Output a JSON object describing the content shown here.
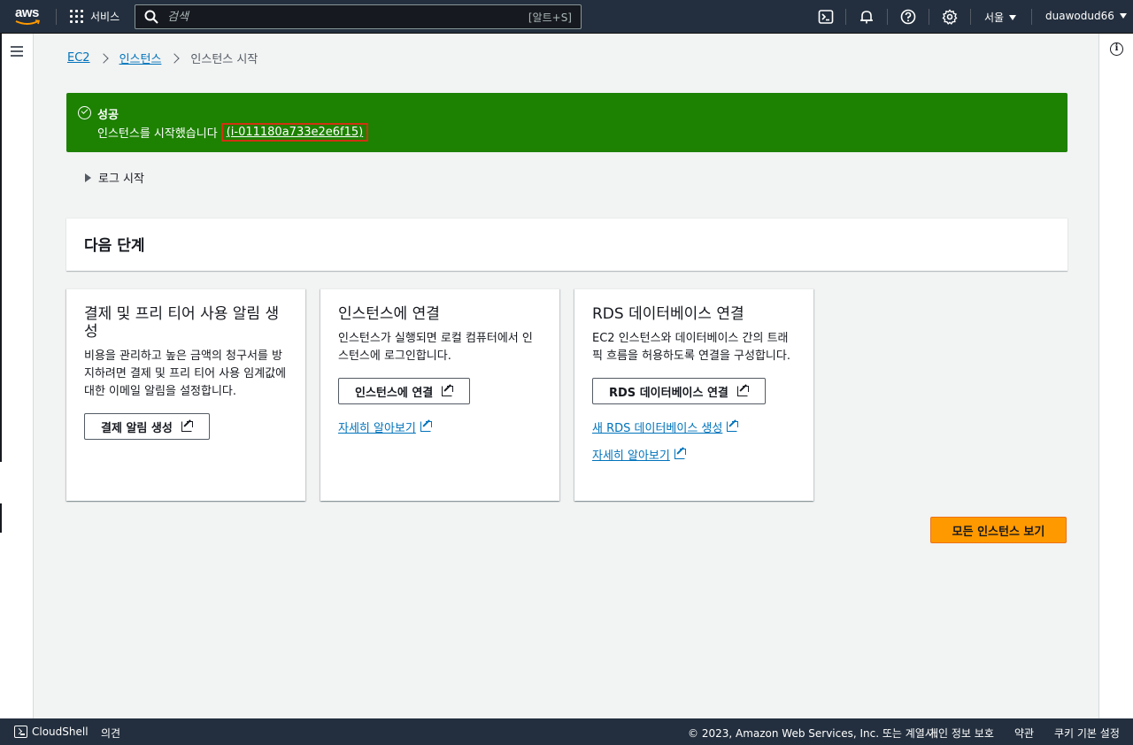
{
  "topnav": {
    "logo": "aws",
    "services_label": "서비스",
    "search_placeholder": "검색",
    "search_shortcut": "[알트+S]",
    "region": "서울",
    "username": "duawodud66",
    "icons": [
      "cloudshell-icon",
      "bell-icon",
      "help-icon",
      "gear-icon"
    ]
  },
  "breadcrumb": {
    "items": [
      "EC2",
      "인스턴스"
    ],
    "current": "인스턴스 시작"
  },
  "flash": {
    "title": "성공",
    "message": "인스턴스를 시작했습니다",
    "instance_id": "(i-011180a733e2e6f15)",
    "color": "#1d8102"
  },
  "log": {
    "label": "로그 시작"
  },
  "next_steps": {
    "title": "다음 단계"
  },
  "cards": [
    {
      "title": "결제 및 프리 티어 사용 알림 생성",
      "description": "비용을 관리하고 높은 금액의 청구서를 방지하려면 결제 및 프리 티어 사용 임계값에 대한 이메일 알림을 설정합니다.",
      "button": "결제 알림 생성"
    },
    {
      "title": "인스턴스에 연결",
      "description": "인스턴스가 실행되면 로컬 컴퓨터에서 인스턴스에 로그인합니다.",
      "button": "인스턴스에 연결",
      "link": "자세히 알아보기"
    },
    {
      "title": "RDS 데이터베이스 연결",
      "description": "EC2 인스턴스와 데이터베이스 간의 트래픽 흐름을 허용하도록 연결을 구성합니다.",
      "button": "RDS 데이터베이스 연결",
      "link1": "새 RDS 데이터베이스 생성",
      "link2": "자세히 알아보기"
    }
  ],
  "primary_button": "모든 인스턴스 보기",
  "footer": {
    "cloudshell": "CloudShell",
    "feedback": "의견",
    "copyright": "© 2023, Amazon Web Services, Inc. 또는 계열사.",
    "privacy": "개인 정보 보호",
    "terms": "약관",
    "cookies": "쿠키 기본 설정"
  },
  "colors": {
    "nav_bg": "#232f3e",
    "link": "#0073bb",
    "primary": "#ff9900",
    "highlight_border": "#d13212"
  }
}
